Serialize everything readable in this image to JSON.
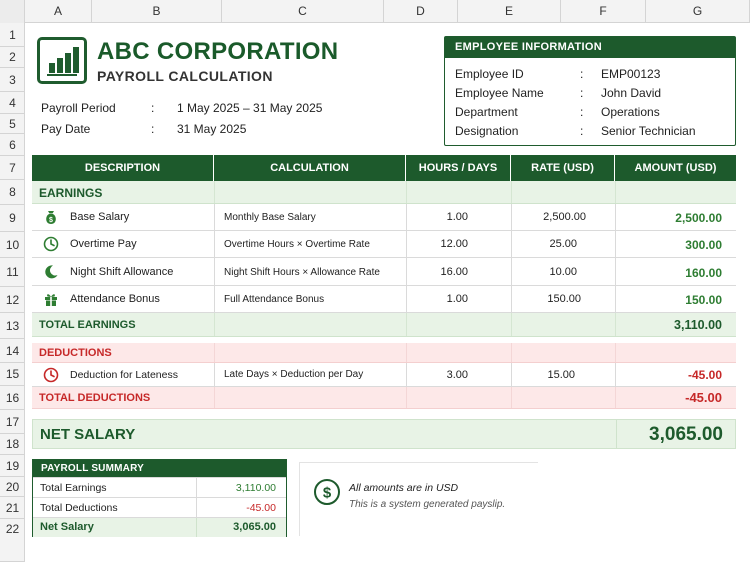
{
  "columns": [
    "A",
    "B",
    "C",
    "D",
    "E",
    "F",
    "G"
  ],
  "rows": [
    "1",
    "2",
    "3",
    "4",
    "5",
    "6",
    "7",
    "8",
    "9",
    "10",
    "11",
    "12",
    "13",
    "14",
    "15",
    "16",
    "17",
    "18",
    "19",
    "20",
    "21",
    "22"
  ],
  "company": {
    "name": "ABC CORPORATION",
    "subtitle": "PAYROLL CALCULATION",
    "icon": "bar-chart-icon"
  },
  "period": {
    "payroll_label": "Payroll Period",
    "payroll_value": "1 May 2025 – 31 May 2025",
    "paydate_label": "Pay Date",
    "paydate_value": "31 May 2025",
    "sep": ":"
  },
  "employee": {
    "title": "EMPLOYEE INFORMATION",
    "fields": [
      {
        "label": "Employee ID",
        "value": "EMP00123"
      },
      {
        "label": "Employee Name",
        "value": "John David"
      },
      {
        "label": "Department",
        "value": "Operations"
      },
      {
        "label": "Designation",
        "value": "Senior Technician"
      }
    ],
    "sep": ":"
  },
  "table": {
    "headers": [
      "DESCRIPTION",
      "CALCULATION",
      "HOURS / DAYS",
      "RATE (USD)",
      "AMOUNT (USD)"
    ],
    "earnings_label": "EARNINGS",
    "earnings": [
      {
        "icon": "money-bag-icon",
        "desc": "Base Salary",
        "calc": "Monthly Base Salary",
        "hours": "1.00",
        "rate": "2,500.00",
        "amount": "2,500.00"
      },
      {
        "icon": "clock-icon",
        "desc": "Overtime Pay",
        "calc": "Overtime Hours × Overtime Rate",
        "hours": "12.00",
        "rate": "25.00",
        "amount": "300.00"
      },
      {
        "icon": "moon-icon",
        "desc": "Night Shift Allowance",
        "calc": "Night Shift Hours × Allowance Rate",
        "hours": "16.00",
        "rate": "10.00",
        "amount": "160.00"
      },
      {
        "icon": "gift-icon",
        "desc": "Attendance Bonus",
        "calc": "Full Attendance Bonus",
        "hours": "1.00",
        "rate": "150.00",
        "amount": "150.00"
      }
    ],
    "total_earnings_label": "TOTAL EARNINGS",
    "total_earnings": "3,110.00",
    "deductions_label": "DEDUCTIONS",
    "deductions": [
      {
        "icon": "clock-icon",
        "desc": "Deduction for Lateness",
        "calc": "Late Days × Deduction per Day",
        "hours": "3.00",
        "rate": "15.00",
        "amount": "-45.00"
      }
    ],
    "total_deductions_label": "TOTAL DEDUCTIONS",
    "total_deductions": "-45.00",
    "net_label": "NET SALARY",
    "net_value": "3,065.00"
  },
  "summary": {
    "title": "PAYROLL SUMMARY",
    "rows": [
      {
        "label": "Total Earnings",
        "value": "3,110.00"
      },
      {
        "label": "Total Deductions",
        "value": "-45.00"
      },
      {
        "label": "Net Salary",
        "value": "3,065.00"
      }
    ]
  },
  "note": {
    "icon": "dollar-circle-icon",
    "line1": "All amounts are in USD",
    "line2": "This is a system generated payslip."
  },
  "colors": {
    "green": "#1d5a2c",
    "green_text": "#2e7d32",
    "red": "#c62828",
    "light_green": "#e8f3e6",
    "light_red": "#fde8e8"
  }
}
